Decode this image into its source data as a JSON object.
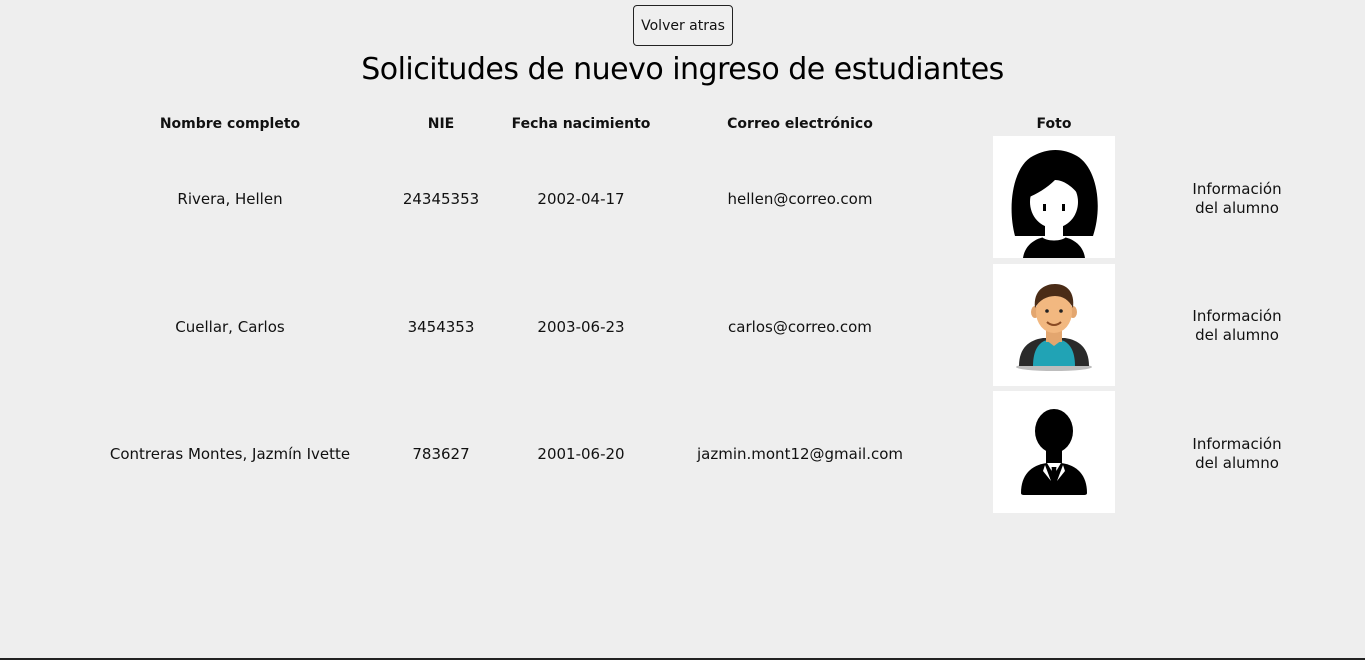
{
  "header": {
    "back_button": "Volver atras",
    "title": "Solicitudes de nuevo ingreso de estudiantes"
  },
  "table": {
    "columns": {
      "name": "Nombre completo",
      "nie": "NIE",
      "birth": "Fecha nacimiento",
      "email": "Correo electrónico",
      "photo": "Foto"
    },
    "rows": [
      {
        "name": "Rivera, Hellen",
        "nie": "24345353",
        "birth": "2002-04-17",
        "email": "hellen@correo.com",
        "photo_icon": "female-avatar-icon",
        "info_line1": "Información",
        "info_line2": "del alumno"
      },
      {
        "name": "Cuellar, Carlos",
        "nie": "3454353",
        "birth": "2003-06-23",
        "email": "carlos@correo.com",
        "photo_icon": "male-avatar-icon",
        "info_line1": "Información",
        "info_line2": "del alumno"
      },
      {
        "name": "Contreras Montes, Jazmín Ivette",
        "nie": "783627",
        "birth": "2001-06-20",
        "email": "jazmin.mont12@gmail.com",
        "photo_icon": "businessman-silhouette-icon",
        "info_line1": "Información",
        "info_line2": "del alumno"
      }
    ]
  }
}
